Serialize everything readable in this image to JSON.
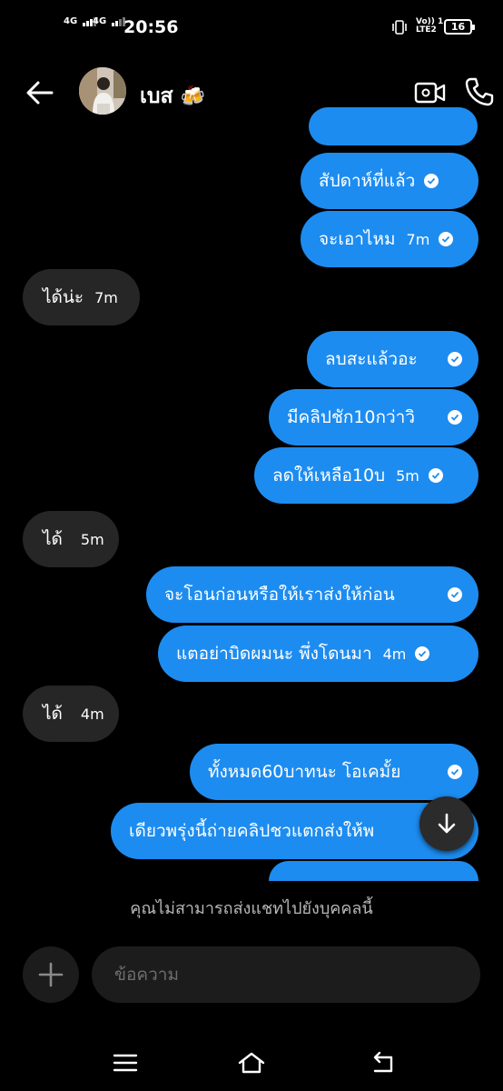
{
  "status_bar": {
    "sim1": "4G",
    "sim2": "4G",
    "time": "20:56",
    "volte_line1": "Vo)) 1",
    "volte_line2": "LTE2",
    "battery": "16"
  },
  "header": {
    "contact_name": "เบส",
    "contact_emoji": "🍻"
  },
  "messages": [
    {
      "text": "",
      "time": "",
      "direction": "out"
    },
    {
      "text": "สัปดาห์ที่แล้ว",
      "time": "",
      "direction": "out"
    },
    {
      "text": "จะเอาไหม",
      "time": "7m",
      "direction": "out"
    },
    {
      "text": "ได้น่ะ",
      "time": "7m",
      "direction": "in"
    },
    {
      "text": "ลบสะแล้วอะ",
      "time": "",
      "direction": "out"
    },
    {
      "text": "มีคลิปชัก10กว่าวิ",
      "time": "",
      "direction": "out"
    },
    {
      "text": "ลดให้เหลือ10บ",
      "time": "5m",
      "direction": "out"
    },
    {
      "text": "ได้",
      "time": "5m",
      "direction": "in"
    },
    {
      "text": "จะโอนก่อนหรือให้เราส่งให้ก่อน",
      "time": "",
      "direction": "out"
    },
    {
      "text": "แตอย่าบิดผมนะ พึ่งโดนมา",
      "time": "4m",
      "direction": "out"
    },
    {
      "text": "ได้",
      "time": "4m",
      "direction": "in"
    },
    {
      "text": "ทั้งหมด60บาทนะ โอเคมั้ย",
      "time": "",
      "direction": "out"
    },
    {
      "text": "เดียวพรุ่งนี้ถ่ายคลิปชวแตกส่งให้พ",
      "time": "",
      "direction": "out"
    },
    {
      "text": "",
      "time": "",
      "direction": "out"
    }
  ],
  "notice": "คุณไม่สามารถส่งแชทไปยังบุคคลนี้",
  "composer": {
    "placeholder": "ข้อความ"
  },
  "colors": {
    "outgoing_bubble": "#1d8cf0",
    "incoming_bubble": "#262626",
    "background": "#000000"
  }
}
